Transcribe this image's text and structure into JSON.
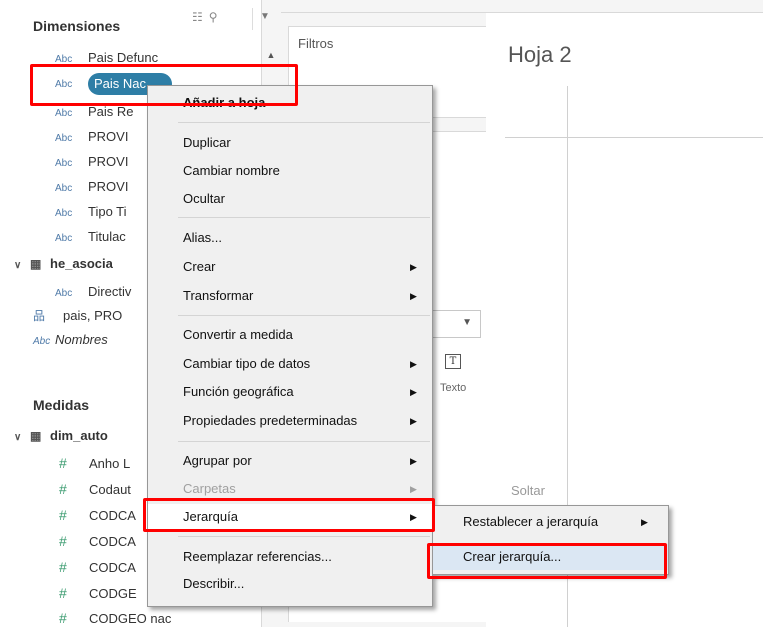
{
  "data_pane": {
    "dimensions_title": "Dimensiones",
    "measures_title": "Medidas",
    "abc": "Abc",
    "hash": "#",
    "dimension_fields": [
      "Pais Defunc",
      "Pais Nac",
      "Pais Re",
      "PROVI",
      "PROVI",
      "PROVI",
      "Tipo Ti",
      "Titulac"
    ],
    "table2": {
      "name": "he_asocia",
      "field": "Directiv"
    },
    "hierarchy": {
      "name": "pais, PRO"
    },
    "names_field": "Nombres",
    "measures_table": "dim_auto",
    "measure_fields": [
      "Anho L",
      "Codaut",
      "CODCA",
      "CODCA",
      "CODCA",
      "CODGE",
      "CODGEO nac"
    ]
  },
  "shelves": {
    "filters_title": "Filtros",
    "text_label": "Texto",
    "text_icon": "T"
  },
  "sheet": {
    "title": "Hoja 2",
    "drop_hint": "Soltar"
  },
  "context_menu": {
    "items": [
      {
        "label": "Añadir a hoja"
      },
      {
        "label": "Duplicar"
      },
      {
        "label": "Cambiar nombre"
      },
      {
        "label": "Ocultar"
      },
      {
        "label": "Alias..."
      },
      {
        "label": "Crear"
      },
      {
        "label": "Transformar"
      },
      {
        "label": "Convertir a medida"
      },
      {
        "label": "Cambiar tipo de datos"
      },
      {
        "label": "Función geográfica"
      },
      {
        "label": "Propiedades predeterminadas"
      },
      {
        "label": "Agrupar por"
      },
      {
        "label": "Carpetas"
      },
      {
        "label": "Jerarquía"
      },
      {
        "label": "Reemplazar referencias..."
      },
      {
        "label": "Describir..."
      }
    ]
  },
  "submenu": {
    "items": [
      {
        "label": "Restablecer a jerarquía"
      },
      {
        "label": "Crear jerarquía..."
      }
    ]
  },
  "colors": {
    "highlight_border": "#ff0000",
    "pill": "#2e7ea6",
    "dimension_icon": "#4f7aa8",
    "measure_icon": "#3a9b6f"
  }
}
